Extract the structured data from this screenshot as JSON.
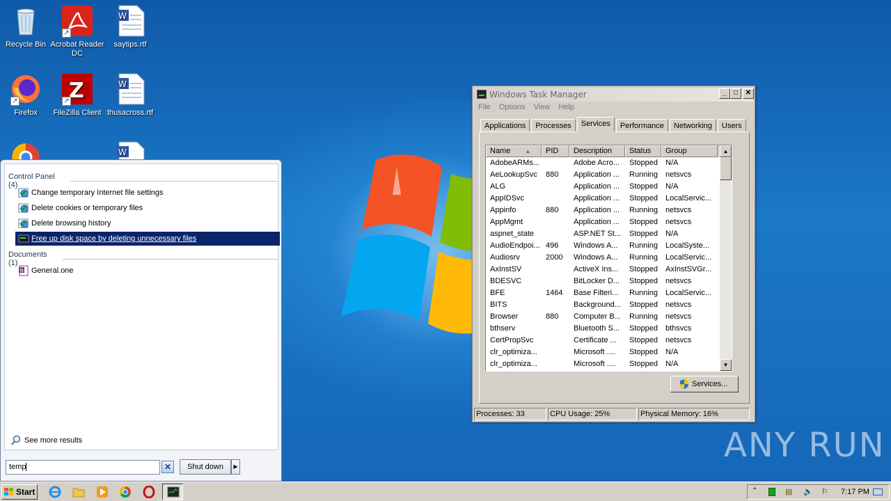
{
  "desktop": {
    "icons": [
      {
        "label": "Recycle Bin",
        "icon": "recycle-bin-icon"
      },
      {
        "label": "Acrobat Reader DC",
        "icon": "acrobat-icon"
      },
      {
        "label": "saytips.rtf",
        "icon": "word-doc-icon"
      },
      {
        "label": "Firefox",
        "icon": "firefox-icon"
      },
      {
        "label": "FileZilla Client",
        "icon": "filezilla-icon"
      },
      {
        "label": "thusacross.rtf",
        "icon": "word-doc-icon"
      }
    ],
    "watermark": "ANY RUN"
  },
  "start_menu": {
    "groups": [
      {
        "header": "Control Panel (4)",
        "items": [
          {
            "label": "Change temporary Internet file settings",
            "icon": "internet-options-icon"
          },
          {
            "label": "Delete cookies or temporary files",
            "icon": "internet-options-icon"
          },
          {
            "label": "Delete browsing history",
            "icon": "internet-options-icon"
          },
          {
            "label": "Free up disk space by deleting unnecessary files",
            "icon": "disk-cleanup-icon",
            "selected": true
          }
        ]
      },
      {
        "header": "Documents (1)",
        "items": [
          {
            "label": "General.one",
            "icon": "onenote-icon"
          }
        ]
      }
    ],
    "see_more": "See more results",
    "search_value": "temp",
    "shutdown_label": "Shut down"
  },
  "task_manager": {
    "title": "Windows Task Manager",
    "menu": [
      "File",
      "Options",
      "View",
      "Help"
    ],
    "tabs": [
      "Applications",
      "Processes",
      "Services",
      "Performance",
      "Networking",
      "Users"
    ],
    "active_tab": "Services",
    "columns": [
      "Name",
      "PID",
      "Description",
      "Status",
      "Group"
    ],
    "rows": [
      [
        "AdobeARMs...",
        "",
        "Adobe Acro...",
        "Stopped",
        "N/A"
      ],
      [
        "AeLookupSvc",
        "880",
        "Application ...",
        "Running",
        "netsvcs"
      ],
      [
        "ALG",
        "",
        "Application ...",
        "Stopped",
        "N/A"
      ],
      [
        "AppIDSvc",
        "",
        "Application ...",
        "Stopped",
        "LocalServic..."
      ],
      [
        "Appinfo",
        "880",
        "Application ...",
        "Running",
        "netsvcs"
      ],
      [
        "AppMgmt",
        "",
        "Application ...",
        "Stopped",
        "netsvcs"
      ],
      [
        "aspnet_state",
        "",
        "ASP.NET St...",
        "Stopped",
        "N/A"
      ],
      [
        "AudioEndpoi...",
        "496",
        "Windows A...",
        "Running",
        "LocalSyste..."
      ],
      [
        "Audiosrv",
        "2000",
        "Windows A...",
        "Running",
        "LocalServic..."
      ],
      [
        "AxInstSV",
        "",
        "ActiveX Ins...",
        "Stopped",
        "AxInstSVGr..."
      ],
      [
        "BDESVC",
        "",
        "BitLocker D...",
        "Stopped",
        "netsvcs"
      ],
      [
        "BFE",
        "1464",
        "Base Filteri...",
        "Running",
        "LocalServic..."
      ],
      [
        "BITS",
        "",
        "Background...",
        "Stopped",
        "netsvcs"
      ],
      [
        "Browser",
        "880",
        "Computer B...",
        "Running",
        "netsvcs"
      ],
      [
        "bthserv",
        "",
        "Bluetooth S...",
        "Stopped",
        "bthsvcs"
      ],
      [
        "CertPropSvc",
        "",
        "Certificate ...",
        "Stopped",
        "netsvcs"
      ],
      [
        "clr_optimiza...",
        "",
        "Microsoft ....",
        "Stopped",
        "N/A"
      ],
      [
        "clr_optimiza...",
        "",
        "Microsoft ....",
        "Stopped",
        "N/A"
      ]
    ],
    "services_button": "Services...",
    "status": {
      "processes": "Processes: 33",
      "cpu": "CPU Usage: 25%",
      "memory": "Physical Memory: 16%"
    }
  },
  "taskbar": {
    "start_label": "Start",
    "clock": "7:17 PM"
  }
}
